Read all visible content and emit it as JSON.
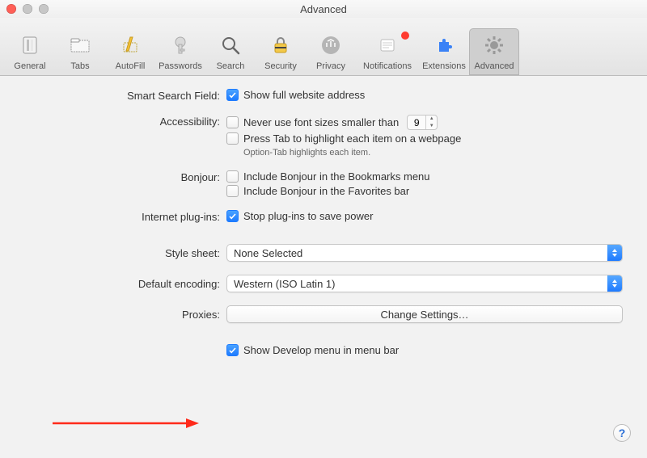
{
  "window": {
    "title": "Advanced"
  },
  "toolbar": {
    "items": [
      {
        "id": "general",
        "label": "General"
      },
      {
        "id": "tabs",
        "label": "Tabs"
      },
      {
        "id": "autofill",
        "label": "AutoFill"
      },
      {
        "id": "passwords",
        "label": "Passwords"
      },
      {
        "id": "search",
        "label": "Search"
      },
      {
        "id": "security",
        "label": "Security"
      },
      {
        "id": "privacy",
        "label": "Privacy"
      },
      {
        "id": "notifications",
        "label": "Notifications",
        "badge": true
      },
      {
        "id": "extensions",
        "label": "Extensions"
      },
      {
        "id": "advanced",
        "label": "Advanced",
        "active": true
      }
    ]
  },
  "sections": {
    "smart_search": {
      "label": "Smart Search Field:",
      "show_full_url": {
        "label": "Show full website address",
        "checked": true
      }
    },
    "accessibility": {
      "label": "Accessibility:",
      "min_font": {
        "label": "Never use font sizes smaller than",
        "checked": false,
        "value": "9"
      },
      "press_tab": {
        "label": "Press Tab to highlight each item on a webpage",
        "checked": false
      },
      "hint": "Option-Tab highlights each item."
    },
    "bonjour": {
      "label": "Bonjour:",
      "bookmarks": {
        "label": "Include Bonjour in the Bookmarks menu",
        "checked": false
      },
      "favorites": {
        "label": "Include Bonjour in the Favorites bar",
        "checked": false
      }
    },
    "plugins": {
      "label": "Internet plug-ins:",
      "stop_power": {
        "label": "Stop plug-ins to save power",
        "checked": true
      }
    },
    "stylesheet": {
      "label": "Style sheet:",
      "value": "None Selected"
    },
    "encoding": {
      "label": "Default encoding:",
      "value": "Western (ISO Latin 1)"
    },
    "proxies": {
      "label": "Proxies:",
      "button": "Change Settings…"
    },
    "develop": {
      "label": "Show Develop menu in menu bar",
      "checked": true
    }
  },
  "help_glyph": "?"
}
